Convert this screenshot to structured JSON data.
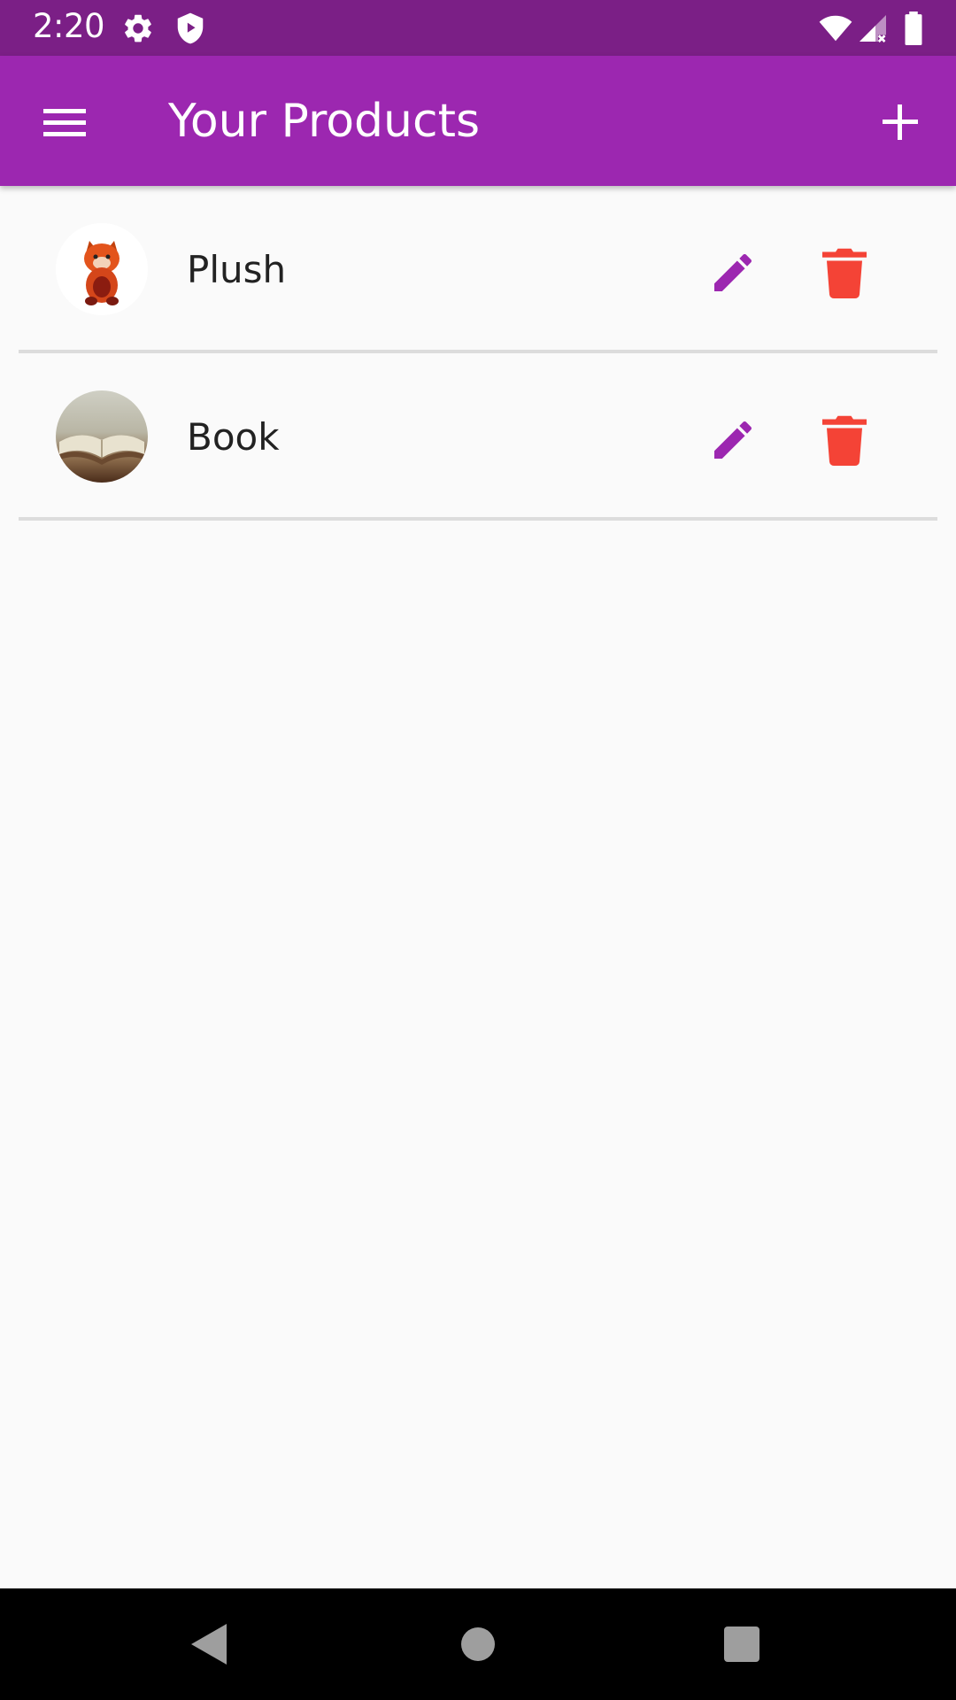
{
  "status_bar": {
    "time": "2:20",
    "icons": [
      "gear-icon",
      "shield-play-icon",
      "wifi-icon",
      "cellular-no-signal-icon",
      "battery-icon"
    ]
  },
  "app_bar": {
    "title": "Your Products",
    "menu_icon": "hamburger-menu-icon",
    "add_icon": "plus-icon"
  },
  "products": [
    {
      "label": "Plush",
      "image": "red-panda-plush-avatar",
      "edit_icon": "pencil-icon",
      "delete_icon": "trash-icon"
    },
    {
      "label": "Book",
      "image": "open-book-avatar",
      "edit_icon": "pencil-icon",
      "delete_icon": "trash-icon"
    }
  ],
  "colors": {
    "status_bar": "#7b1f86",
    "app_bar": "#9c27b0",
    "edit_accent": "#9c27b0",
    "delete_accent": "#f44336",
    "background": "#fafafa"
  },
  "nav_bar": {
    "icons": [
      "back-triangle-icon",
      "home-circle-icon",
      "recents-square-icon"
    ]
  }
}
